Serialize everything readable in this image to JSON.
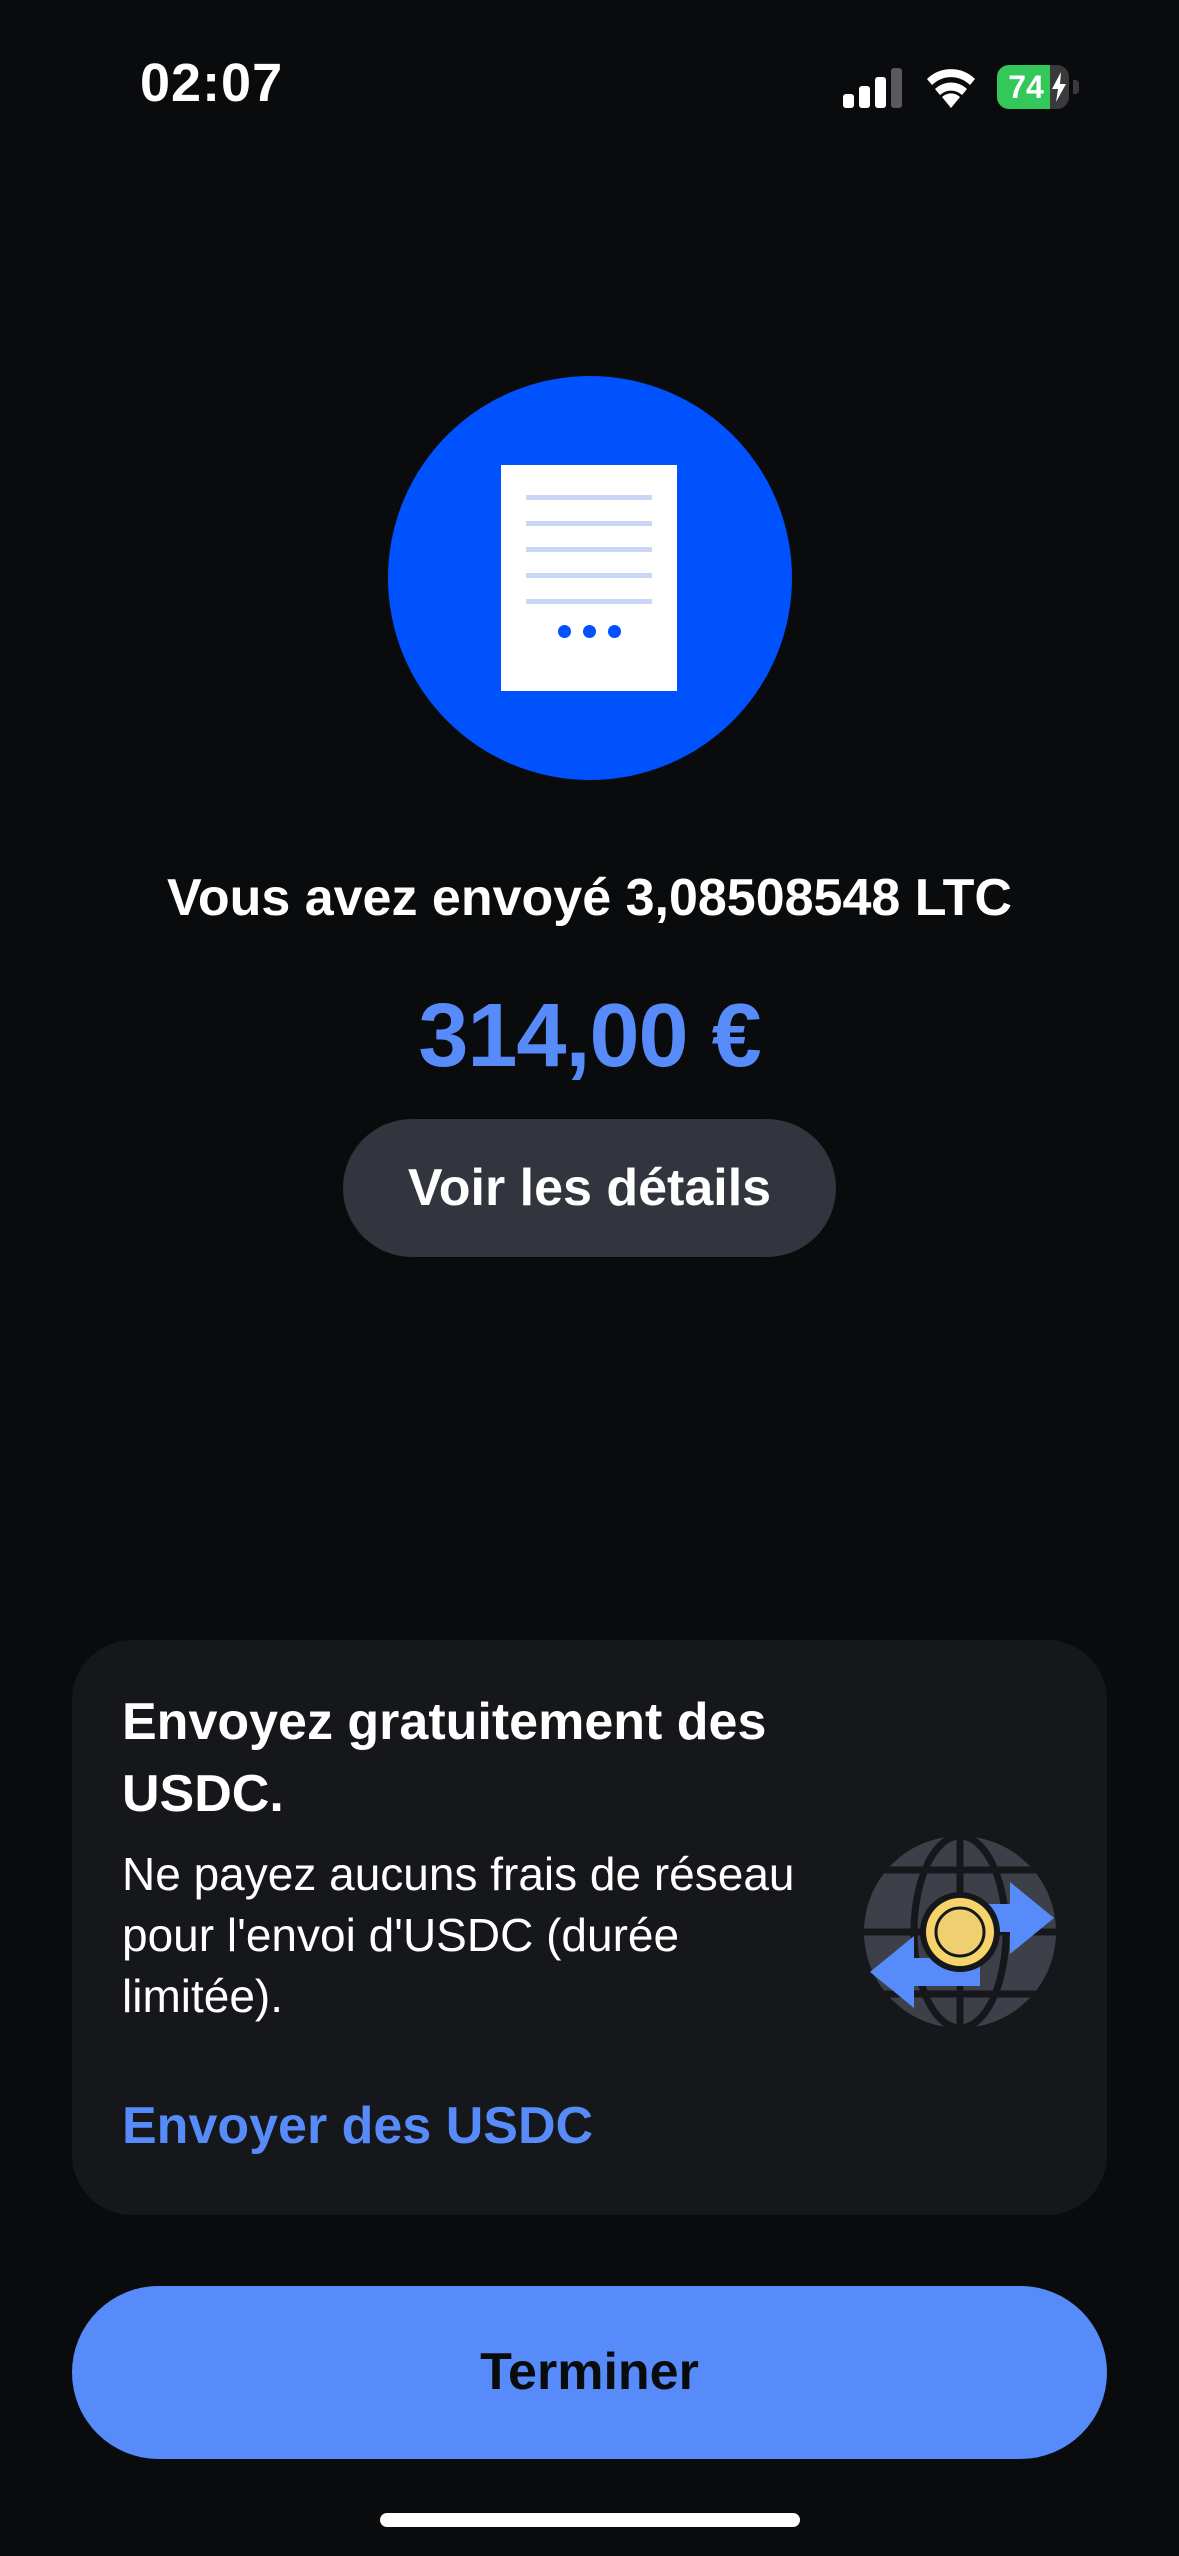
{
  "status_bar": {
    "time": "02:07",
    "battery_percent": "74",
    "battery_level": 0.74,
    "signal_icon": "cellular-signal-icon",
    "wifi_icon": "wifi-icon",
    "battery_icon": "battery-charging-icon"
  },
  "receipt": {
    "icon": "receipt-icon",
    "circle_color": "#0052ff"
  },
  "transaction": {
    "sent_text": "Vous avez envoyé 3,08508548 LTC",
    "fiat_amount": "314,00 €",
    "details_label": "Voir les détails"
  },
  "promo": {
    "title": "Envoyez gratuitement des USDC.",
    "body": "Ne payez aucuns frais de réseau pour l'envoi d'USDC (durée limitée).",
    "link_label": "Envoyer des USDC",
    "icon": "globe-transfer-icon"
  },
  "footer": {
    "finish_label": "Terminer"
  },
  "colors": {
    "background": "#0a0b0d",
    "accent": "#578bfa",
    "brand_blue": "#0052ff",
    "card": "#16171a",
    "secondary_button": "#32353d"
  }
}
